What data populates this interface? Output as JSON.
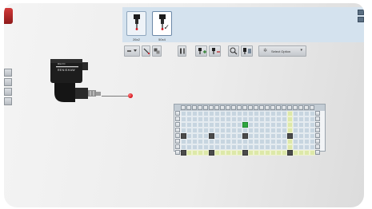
{
  "probe_library": {
    "tiles": [
      {
        "label": "26x2",
        "selected": false
      },
      {
        "label": "50x4",
        "selected": true
      }
    ]
  },
  "probe_head": {
    "brand": "RENISHAW",
    "model_text": "REVO"
  },
  "toolbar": {
    "buttons": [
      {
        "icon": "stylus-dropdown-icon"
      },
      {
        "icon": "stylus-angle-icon"
      },
      {
        "icon": "component-icon"
      },
      {
        "icon": "tool-list-icon"
      },
      {
        "icon": "add-probe-icon"
      },
      {
        "icon": "remove-probe-icon"
      },
      {
        "icon": "magnify-icon"
      },
      {
        "icon": "probe-config-icon"
      }
    ],
    "dropdown": {
      "icon": "gear-icon",
      "value": "Select Option"
    }
  },
  "grid": {
    "columns": 24,
    "rows": 8,
    "highlight_column": 20,
    "highlight_row": 8,
    "green_cells": [
      [
        3,
        12
      ]
    ],
    "dark_cells": [
      [
        5,
        1
      ],
      [
        5,
        6
      ],
      [
        5,
        12
      ],
      [
        5,
        20
      ],
      [
        8,
        1
      ],
      [
        8,
        6
      ],
      [
        8,
        12
      ],
      [
        8,
        20
      ]
    ]
  },
  "colors": {
    "accent_red": "#d4101a",
    "panel_blue": "#d4e2ee",
    "grid_highlight": "#dde8a8",
    "grid_cell": "#c7d5e0",
    "grid_active": "#2fa640",
    "grid_marker": "#4a4a4a"
  }
}
